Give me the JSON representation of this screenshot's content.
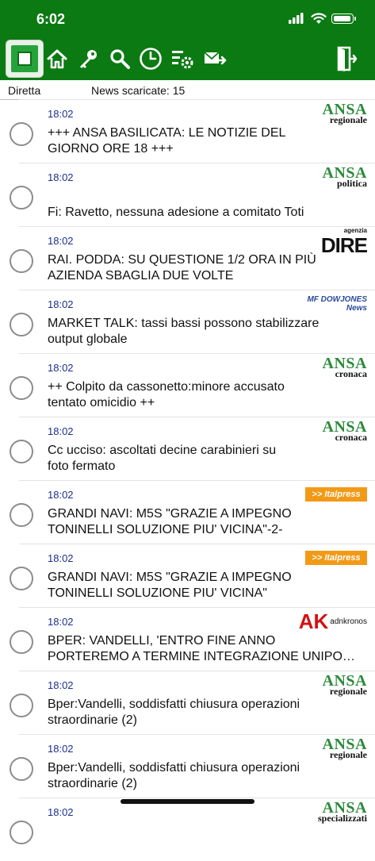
{
  "status_bar": {
    "time": "6:02"
  },
  "toolbar": {
    "icons": [
      "app-logo-icon",
      "home-icon",
      "key-icon",
      "search-icon",
      "clock-icon",
      "settings-icon",
      "mail-forward-icon",
      "exit-icon"
    ]
  },
  "subbar": {
    "live_label": "Diretta",
    "downloaded_label": "News scaricate: 15"
  },
  "news": [
    {
      "time": "18:02",
      "title": "+++ ANSA BASILICATA: LE NOTIZIE DEL\nGIORNO ORE 18 +++",
      "source": "ansa",
      "source_top": "ANSA",
      "source_sub": "regionale"
    },
    {
      "time": "18:02",
      "title": "\nFi: Ravetto, nessuna adesione a comitato Toti",
      "source": "ansa",
      "source_top": "ANSA",
      "source_sub": "politica"
    },
    {
      "time": "18:02",
      "title": "RAI. PODDA: SU QUESTIONE 1/2 ORA IN PIÙ\nAZIENDA SBAGLIA DUE VOLTE",
      "source": "dire",
      "source_top": "DIRE",
      "source_sub": "agenzia"
    },
    {
      "time": "18:02",
      "title": "MARKET TALK: tassi bassi possono stabilizzare\noutput globale",
      "source": "mf",
      "source_top": "MF DOWJONES",
      "source_sub": "News"
    },
    {
      "time": "18:02",
      "title": "++ Colpito da cassonetto:minore accusato\ntentato omicidio ++",
      "source": "ansa",
      "source_top": "ANSA",
      "source_sub": "cronaca"
    },
    {
      "time": "18:02",
      "title": "Cc ucciso: ascoltati decine carabinieri su\nfoto fermato",
      "source": "ansa",
      "source_top": "ANSA",
      "source_sub": "cronaca"
    },
    {
      "time": "18:02",
      "title": "GRANDI NAVI: M5S \"GRAZIE A IMPEGNO\nTONINELLI SOLUZIONE PIU' VICINA\"-2-",
      "source": "italpress",
      "source_top": ">> Italpress",
      "source_sub": ""
    },
    {
      "time": "18:02",
      "title": "GRANDI NAVI: M5S \"GRAZIE A IMPEGNO\nTONINELLI SOLUZIONE PIU' VICINA\"",
      "source": "italpress",
      "source_top": ">> Italpress",
      "source_sub": ""
    },
    {
      "time": "18:02",
      "title": "BPER: VANDELLI, 'ENTRO FINE ANNO\nPORTEREMO A TERMINE INTEGRAZIONE UNIPO…",
      "source": "adn",
      "source_top": "AK",
      "source_sub": "adnkronos"
    },
    {
      "time": "18:02",
      "title": "Bper:Vandelli, soddisfatti chiusura operazioni\nstraordinarie (2)",
      "source": "ansa",
      "source_top": "ANSA",
      "source_sub": "regionale"
    },
    {
      "time": "18:02",
      "title": "Bper:Vandelli, soddisfatti chiusura operazioni\nstraordinarie (2)",
      "source": "ansa",
      "source_top": "ANSA",
      "source_sub": "regionale"
    },
    {
      "time": "18:02",
      "title": "",
      "source": "ansa",
      "source_top": "ANSA",
      "source_sub": "specializzati"
    }
  ]
}
